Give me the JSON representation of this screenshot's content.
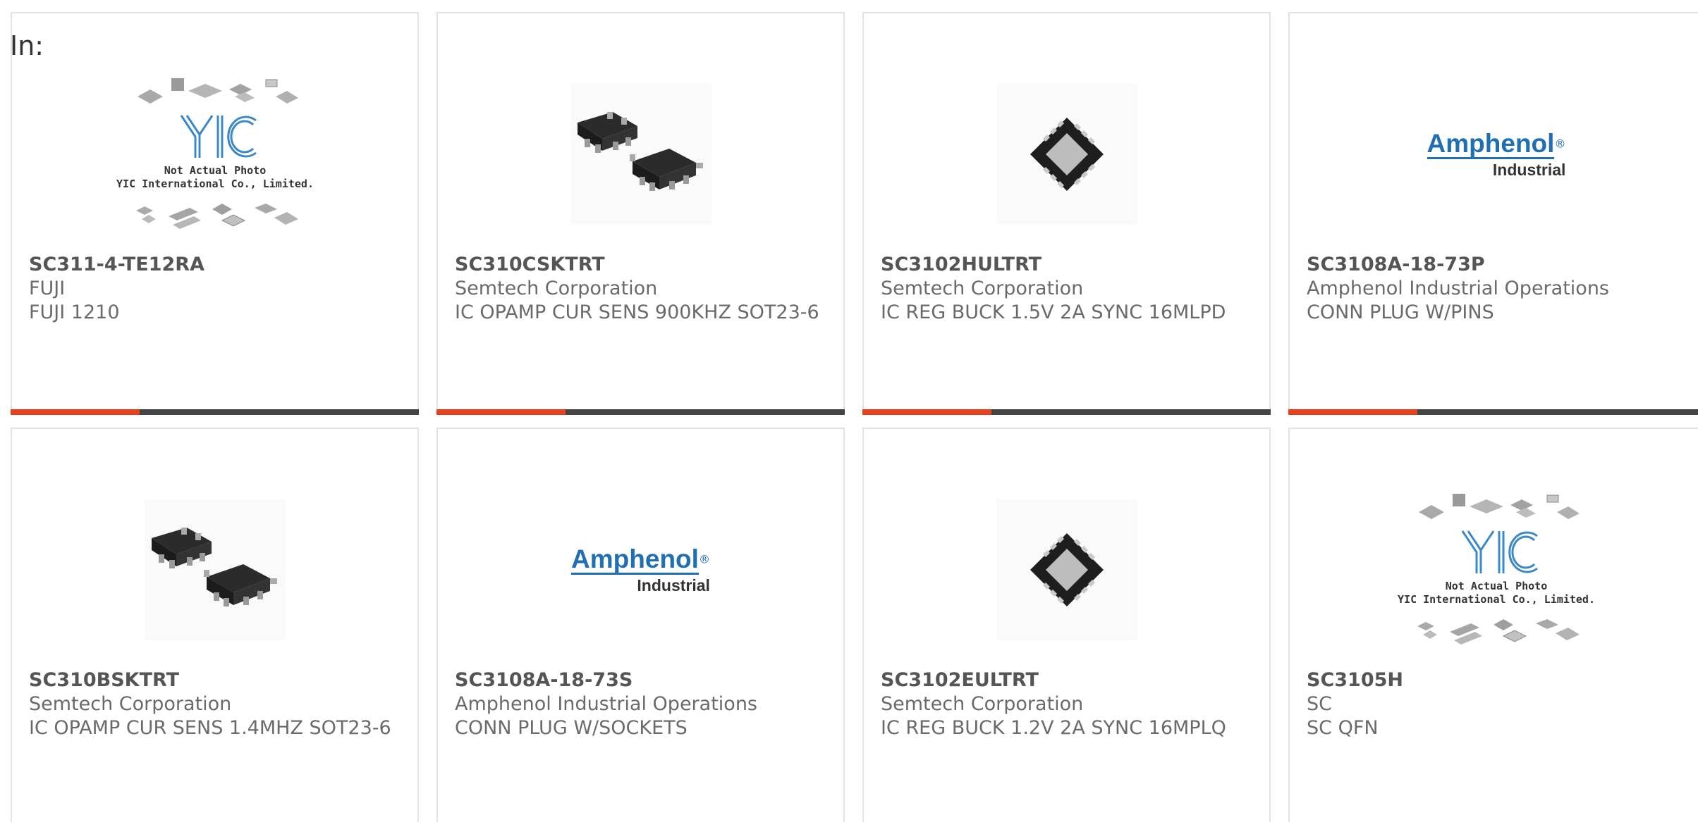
{
  "header": {
    "label": "In:"
  },
  "products": [
    {
      "part": "SC311-4-TE12RA",
      "manufacturer": "FUJI",
      "description": "FUJI 1210",
      "image": "yic-placeholder"
    },
    {
      "part": "SC310CSKTRT",
      "manufacturer": "Semtech Corporation",
      "description": "IC OPAMP CUR SENS 900KHZ SOT23-6",
      "image": "sot23-6-package"
    },
    {
      "part": "SC3102HULTRT",
      "manufacturer": "Semtech Corporation",
      "description": "IC REG BUCK 1.5V 2A SYNC 16MLPD",
      "image": "qfn-16-package"
    },
    {
      "part": "SC3108A-18-73P",
      "manufacturer": "Amphenol Industrial Operations",
      "description": "CONN PLUG W/PINS",
      "image": "amphenol-logo"
    },
    {
      "part": "SC310BSKTRT",
      "manufacturer": "Semtech Corporation",
      "description": "IC OPAMP CUR SENS 1.4MHZ SOT23-6",
      "image": "sot23-6-package"
    },
    {
      "part": "SC3108A-18-73S",
      "manufacturer": "Amphenol Industrial Operations",
      "description": "CONN PLUG W/SOCKETS",
      "image": "amphenol-logo"
    },
    {
      "part": "SC3102EULTRT",
      "manufacturer": "Semtech Corporation",
      "description": "IC REG BUCK 1.2V 2A SYNC 16MPLQ",
      "image": "qfn-16-package"
    },
    {
      "part": "SC3105H",
      "manufacturer": "SC",
      "description": "SC QFN",
      "image": "yic-placeholder"
    }
  ],
  "logos": {
    "amphenol": {
      "main": "Amphenol",
      "registered": "®",
      "sub": "Industrial"
    },
    "yic": {
      "mark": "YIC",
      "line1": "Not Actual Photo",
      "line2": "YIC International Co., Limited."
    }
  },
  "colors": {
    "accent": "#e8401c",
    "bar": "#444444",
    "amphenol_blue": "#1f6fb2",
    "card_border": "#e2e2e2"
  }
}
